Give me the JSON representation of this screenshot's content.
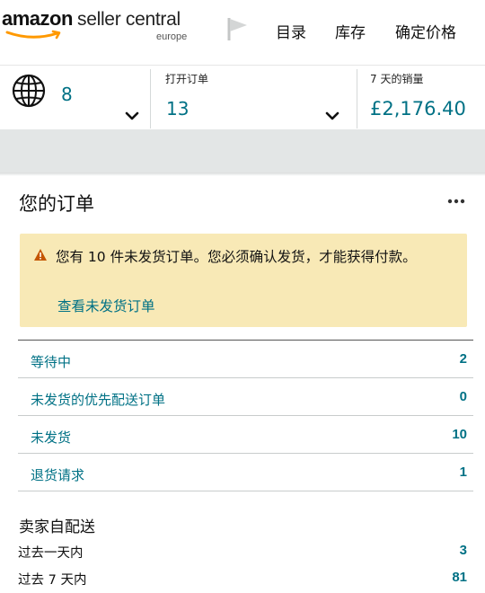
{
  "header": {
    "logo": {
      "brand": "amazon",
      "product": "seller central",
      "region": "europe"
    },
    "nav": [
      {
        "label": "目录"
      },
      {
        "label": "库存"
      },
      {
        "label": "确定价格"
      }
    ]
  },
  "stats": {
    "marketplaces": {
      "value": "8"
    },
    "open_orders": {
      "label": "打开订单",
      "value": "13"
    },
    "sales_7d": {
      "label": "7 天的销量",
      "value": "£2,176.40"
    }
  },
  "orders": {
    "title": "您的订单",
    "alert": {
      "text": "您有 10 件未发货订单。您必须确认发货，才能获得付款。",
      "link": "查看未发货订单"
    },
    "rows": [
      {
        "label": "等待中",
        "count": "2"
      },
      {
        "label": "未发货的优先配送订单",
        "count": "0"
      },
      {
        "label": "未发货",
        "count": "10"
      },
      {
        "label": "退货请求",
        "count": "1"
      }
    ],
    "seller_fulfilled": {
      "title": "卖家自配送",
      "periods": [
        {
          "label": "过去一天内",
          "count": "3"
        },
        {
          "label": "过去 7 天内",
          "count": "81"
        }
      ]
    }
  },
  "colors": {
    "link": "#007185",
    "alert_bg": "#f8e9b6",
    "band": "#e3e6e6",
    "logo_smile": "#ff9900"
  },
  "icons": [
    "amazon-smile-icon",
    "flag-icon",
    "globe-icon",
    "chevron-down-icon",
    "more-icon",
    "warning-icon"
  ]
}
